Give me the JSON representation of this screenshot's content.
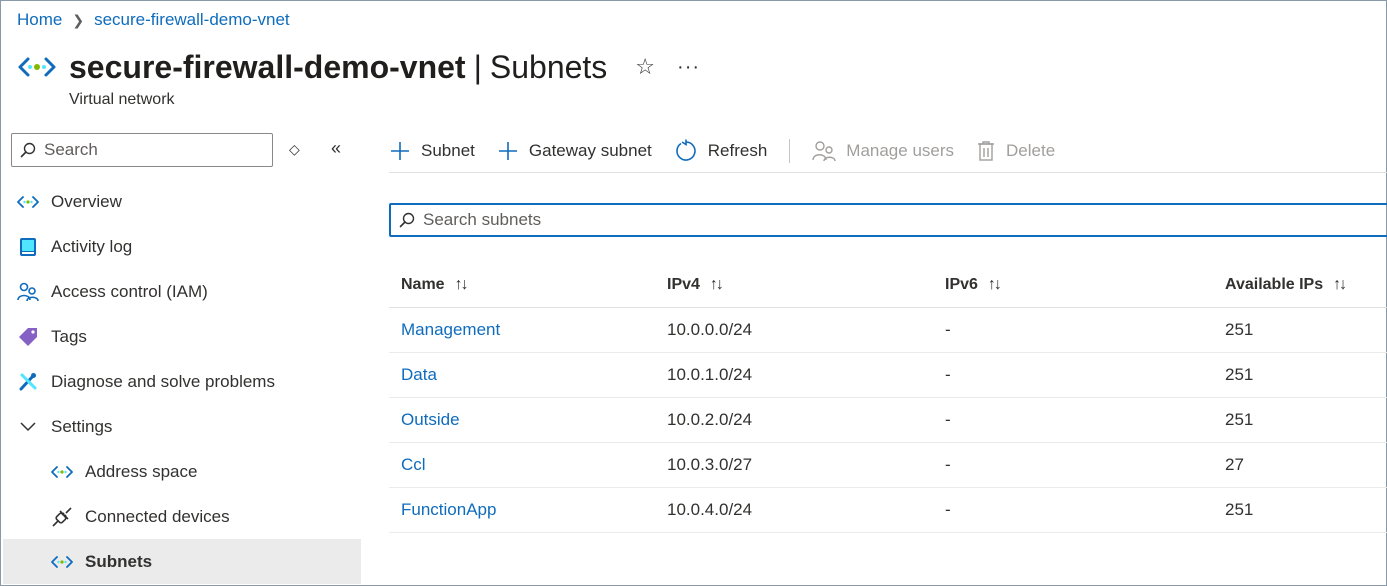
{
  "breadcrumb": {
    "home": "Home",
    "current": "secure-firewall-demo-vnet"
  },
  "header": {
    "resource_name": "secure-firewall-demo-vnet",
    "separator": "|",
    "section": "Subnets",
    "subtitle": "Virtual network",
    "favorite_icon": "star-icon",
    "more_label": "···"
  },
  "sidebar": {
    "search_placeholder": "Search",
    "items": [
      {
        "label": "Overview",
        "icon": "vnet-icon"
      },
      {
        "label": "Activity log",
        "icon": "activity-log-icon"
      },
      {
        "label": "Access control (IAM)",
        "icon": "people-icon"
      },
      {
        "label": "Tags",
        "icon": "tag-icon"
      },
      {
        "label": "Diagnose and solve problems",
        "icon": "wrench-icon"
      },
      {
        "label": "Settings",
        "icon": "chevron-down-icon"
      },
      {
        "label": "Address space",
        "icon": "vnet-icon"
      },
      {
        "label": "Connected devices",
        "icon": "plug-icon"
      },
      {
        "label": "Subnets",
        "icon": "vnet-icon",
        "active": true
      }
    ]
  },
  "toolbar": {
    "add_subnet": "Subnet",
    "add_gateway_subnet": "Gateway subnet",
    "refresh": "Refresh",
    "manage_users": "Manage users",
    "delete": "Delete"
  },
  "subnet_search": {
    "placeholder": "Search subnets"
  },
  "table": {
    "columns": [
      "Name",
      "IPv4",
      "IPv6",
      "Available IPs"
    ],
    "sort_glyph": "↑↓",
    "rows": [
      {
        "name": "Management",
        "ipv4": "10.0.0.0/24",
        "ipv6": "-",
        "available": "251"
      },
      {
        "name": "Data",
        "ipv4": "10.0.1.0/24",
        "ipv6": "-",
        "available": "251"
      },
      {
        "name": "Outside",
        "ipv4": "10.0.2.0/24",
        "ipv6": "-",
        "available": "251"
      },
      {
        "name": "Ccl",
        "ipv4": "10.0.3.0/27",
        "ipv6": "-",
        "available": "27"
      },
      {
        "name": "FunctionApp",
        "ipv4": "10.0.4.0/24",
        "ipv6": "-",
        "available": "251"
      }
    ]
  },
  "colors": {
    "accent": "#0f6cbd",
    "vnet_icon": "#50e6ff",
    "tag": "#8661c5",
    "active_bg": "#ebebeb"
  }
}
